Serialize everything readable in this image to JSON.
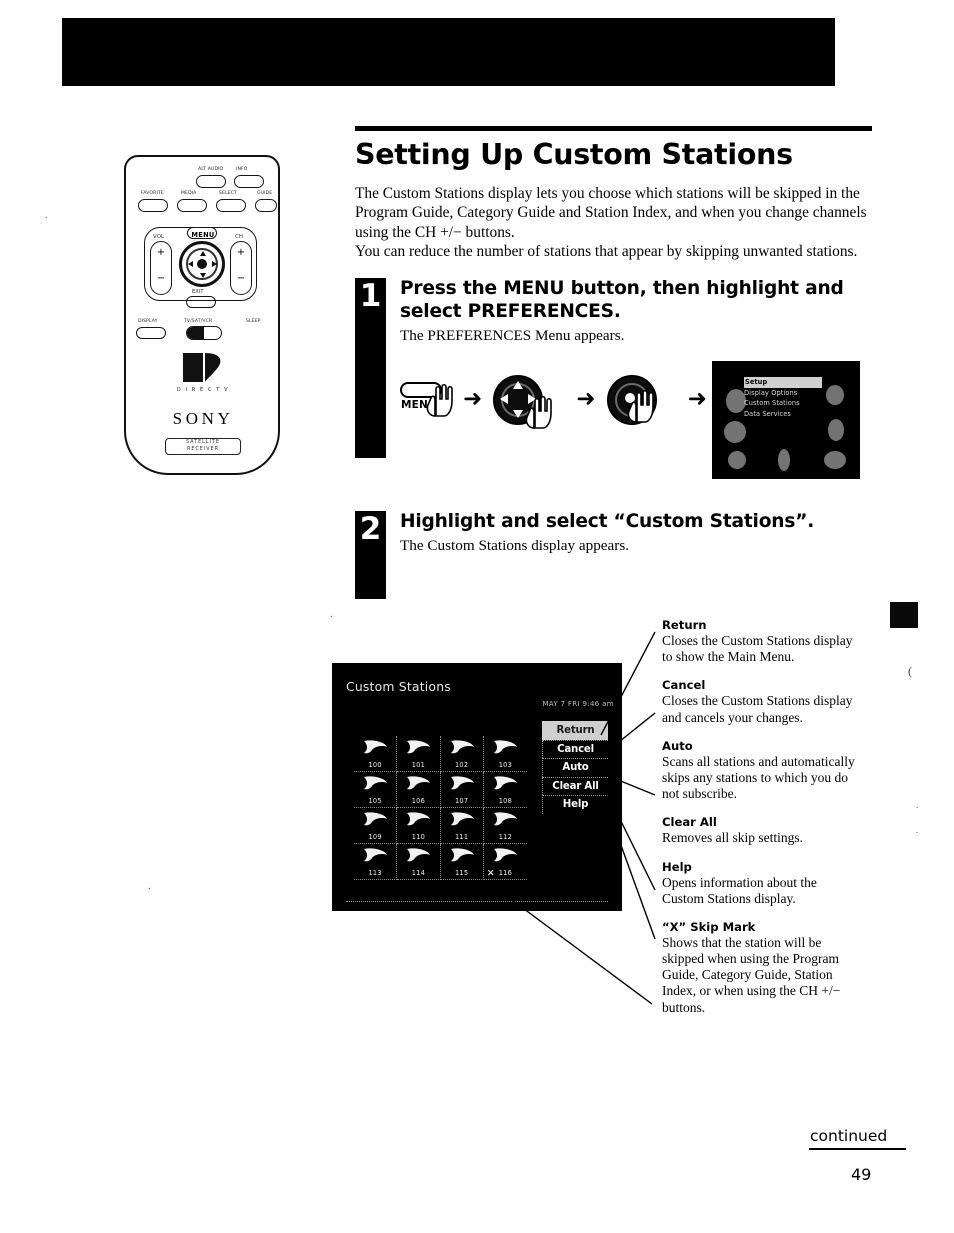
{
  "document": {
    "page_number": "49",
    "continued_label": "continued"
  },
  "heading": {
    "title": "Setting Up Custom Stations"
  },
  "intro": {
    "paragraph1": "The Custom Stations display lets you choose which stations will be skipped in the Program Guide, Category Guide and Station Index, and when you change channels using the CH +/− buttons.",
    "paragraph2": "You can reduce the number of stations that appear by skipping unwanted stations."
  },
  "steps": [
    {
      "number": "1",
      "heading": "Press the MENU button, then highlight and select PREFERENCES.",
      "subtext": "The PREFERENCES Menu appears."
    },
    {
      "number": "2",
      "heading": "Highlight and select “Custom Stations”.",
      "subtext": "The Custom Stations display appears."
    }
  ],
  "sequence_diagram": {
    "menu_button_label": "MENU",
    "arrow_glyph": "➜"
  },
  "preferences_screen": {
    "items": [
      {
        "label": "Setup",
        "selected": true
      },
      {
        "label": "Display Options",
        "selected": false
      },
      {
        "label": "Custom Stations",
        "selected": false
      },
      {
        "label": "Data Services",
        "selected": false
      }
    ]
  },
  "tv_screen": {
    "title": "Custom Stations",
    "datetime": "MAY 7 FRI 9:46 am",
    "skip_mark_glyph": "✕",
    "stations": [
      {
        "channel": "100",
        "skipped": false
      },
      {
        "channel": "101",
        "skipped": false
      },
      {
        "channel": "102",
        "skipped": false
      },
      {
        "channel": "103",
        "skipped": false
      },
      {
        "channel": "105",
        "skipped": false
      },
      {
        "channel": "106",
        "skipped": false
      },
      {
        "channel": "107",
        "skipped": false
      },
      {
        "channel": "108",
        "skipped": false
      },
      {
        "channel": "109",
        "skipped": false
      },
      {
        "channel": "110",
        "skipped": false
      },
      {
        "channel": "111",
        "skipped": false
      },
      {
        "channel": "112",
        "skipped": false
      },
      {
        "channel": "113",
        "skipped": false
      },
      {
        "channel": "114",
        "skipped": false
      },
      {
        "channel": "115",
        "skipped": false
      },
      {
        "channel": "116",
        "skipped": true
      }
    ],
    "buttons": [
      {
        "label": "Return",
        "highlighted": true
      },
      {
        "label": "Cancel",
        "highlighted": false
      },
      {
        "label": "Auto",
        "highlighted": false
      },
      {
        "label": "Clear All",
        "highlighted": false
      },
      {
        "label": "Help",
        "highlighted": false
      }
    ]
  },
  "callouts": [
    {
      "title": "Return",
      "description": "Closes the Custom Stations display to show the Main Menu."
    },
    {
      "title": "Cancel",
      "description": "Closes the Custom Stations display and cancels your changes."
    },
    {
      "title": "Auto",
      "description": "Scans all stations and automatically skips any stations to which you do not subscribe."
    },
    {
      "title": "Clear All",
      "description": "Removes all skip settings."
    },
    {
      "title": "Help",
      "description": "Opens information about the Custom Stations display."
    },
    {
      "title": "“X” Skip Mark",
      "description": "Shows that the station will be skipped when using the Program Guide, Category Guide, Station Index, or when using the CH +/− buttons."
    }
  ],
  "remote": {
    "brand": "SONY",
    "directv_label": "D I R E C T V",
    "receiver_line1": "SATELLITE",
    "receiver_line2": "RECEIVER",
    "vol_label": "VOL",
    "ch_label": "CH",
    "menu_label": "MENU",
    "exit_label": "EXIT",
    "plus_label": "+",
    "minus_label": "−",
    "top_keys": [
      "FAVORITE",
      "ALT AUDIO",
      "INFO",
      "GUIDE",
      "MEDIA",
      "SELECT"
    ],
    "bottom_keys": [
      "DISPLAY",
      "TV/SAT/VCR",
      "SLEEP"
    ]
  },
  "scan_artifacts": {
    "speck": "(",
    "dot": "."
  }
}
